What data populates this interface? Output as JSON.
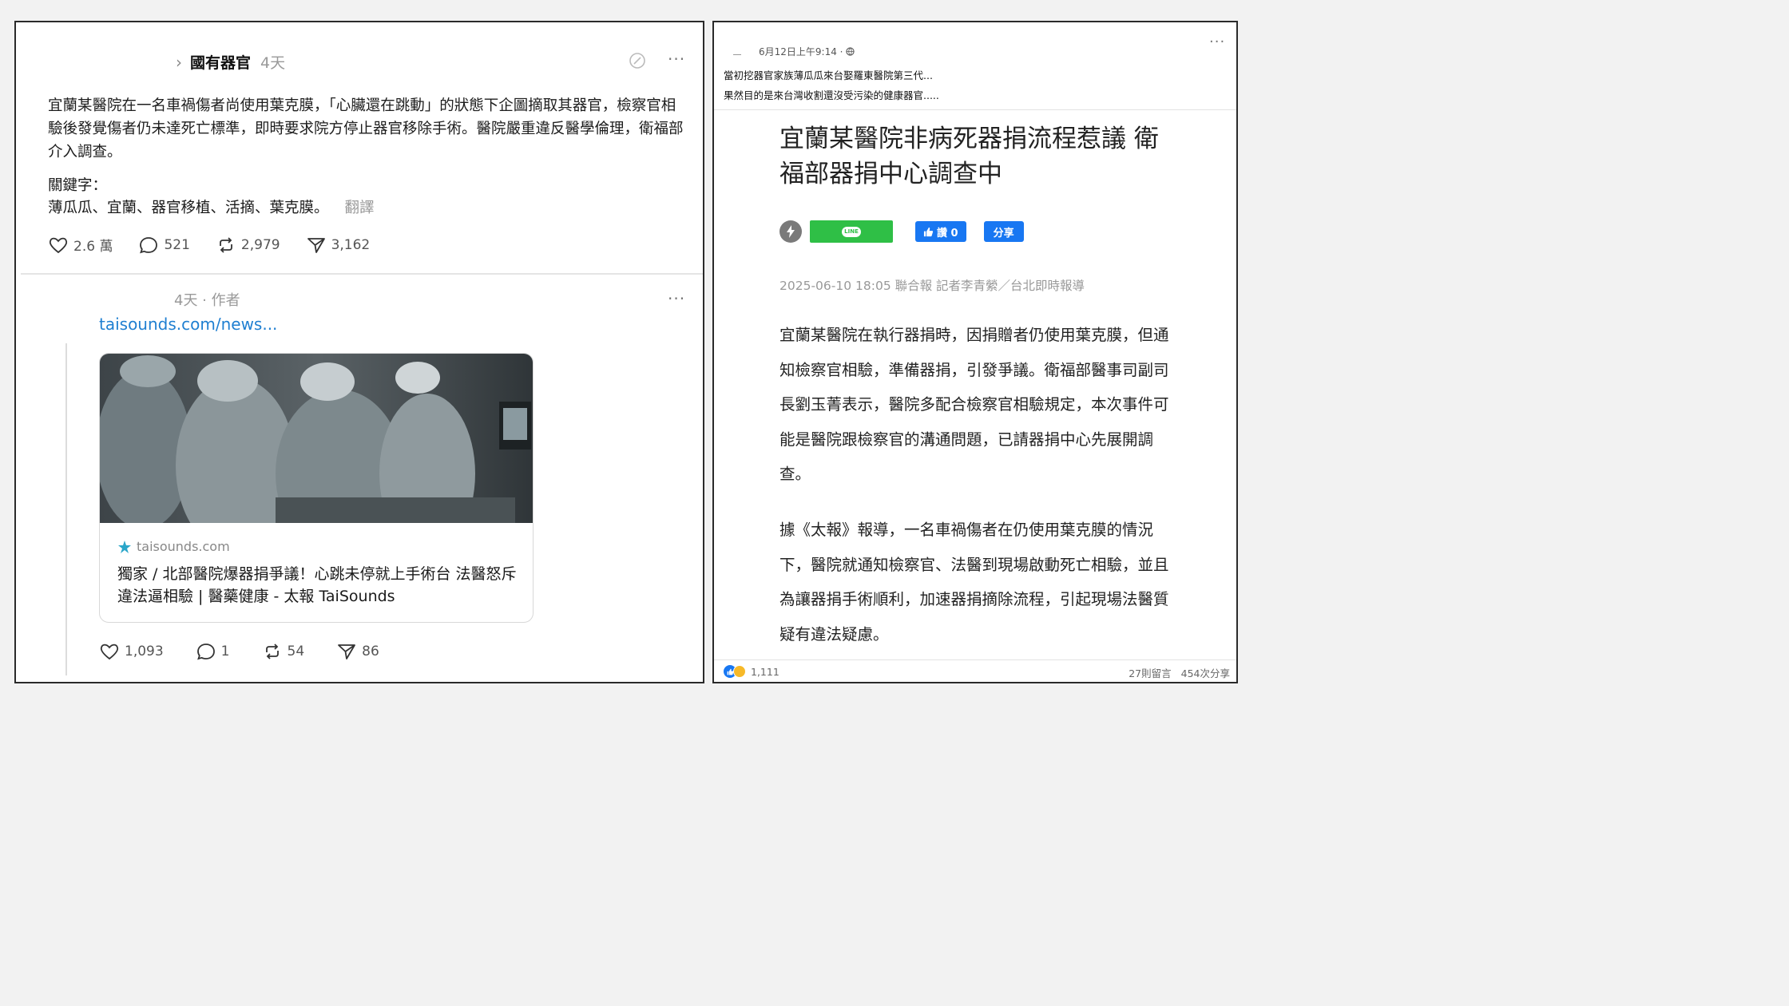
{
  "left_post": {
    "author": "國有器官",
    "time": "4天",
    "body": "宜蘭某醫院在一名車禍傷者尚使用葉克膜，「心臟還在跳動」的狀態下企圖摘取其器官，檢察官相驗後發覺傷者仍未達死亡標準，即時要求院方停止器官移除手術。醫院嚴重違反醫學倫理，衛福部介入調查。",
    "keywords_label": "關鍵字：",
    "keywords": "薄瓜瓜、宜蘭、器官移植、活摘、葉克膜。",
    "translate": "翻譯",
    "stats": {
      "likes": "2.6 萬",
      "comments": "521",
      "reposts": "2,979",
      "shares": "3,162"
    }
  },
  "left_reply": {
    "meta": "4天 · 作者",
    "link": "taisounds.com/news...",
    "card": {
      "domain": "taisounds.com",
      "title": "獨家 / 北部醫院爆器捐爭議！心跳未停就上手術台 法醫怒斥違法逼相驗 | 醫藥健康 - 太報 TaiSounds"
    },
    "stats": {
      "likes": "1,093",
      "comments": "1",
      "reposts": "54",
      "shares": "86"
    }
  },
  "fb_post": {
    "timestamp": "6月12日上午9:14 ·",
    "line1": "當初挖器官家族薄瓜瓜來台娶羅東醫院第三代...",
    "line2": "果然目的是來台灣收割還沒受污染的健康器官....."
  },
  "article": {
    "title": "宜蘭某醫院非病死器捐流程惹議 衛福部器捐中心調查中",
    "line_label": "LINE",
    "like_label": "讚 0",
    "share_label": "分享",
    "meta": "2025-06-10 18:05 聯合報 記者李青縈／台北即時報導",
    "p1": "宜蘭某醫院在執行器捐時，因捐贈者仍使用葉克膜，但通知檢察官相驗，準備器捐，引發爭議。衛福部醫事司副司長劉玉菁表示，醫院多配合檢察官相驗規定，本次事件可能是醫院跟檢察官的溝通問題，已請器捐中心先展開調查。",
    "p2": "據《太報》報導，一名車禍傷者在仍使用葉克膜的情況下，醫院就通知檢察官、法醫到現場啟動死亡相驗，並且為讓器捐手術順利，加速器捐摘除流程，引起現場法醫質疑有違法疑慮。"
  },
  "fb_footer": {
    "reactions": "1,111",
    "comments": "27則留言",
    "shares": "454次分享"
  },
  "colors": {
    "link": "#1f7fd1",
    "fb_blue": "#1877f2",
    "line_green": "#2fbf46"
  }
}
